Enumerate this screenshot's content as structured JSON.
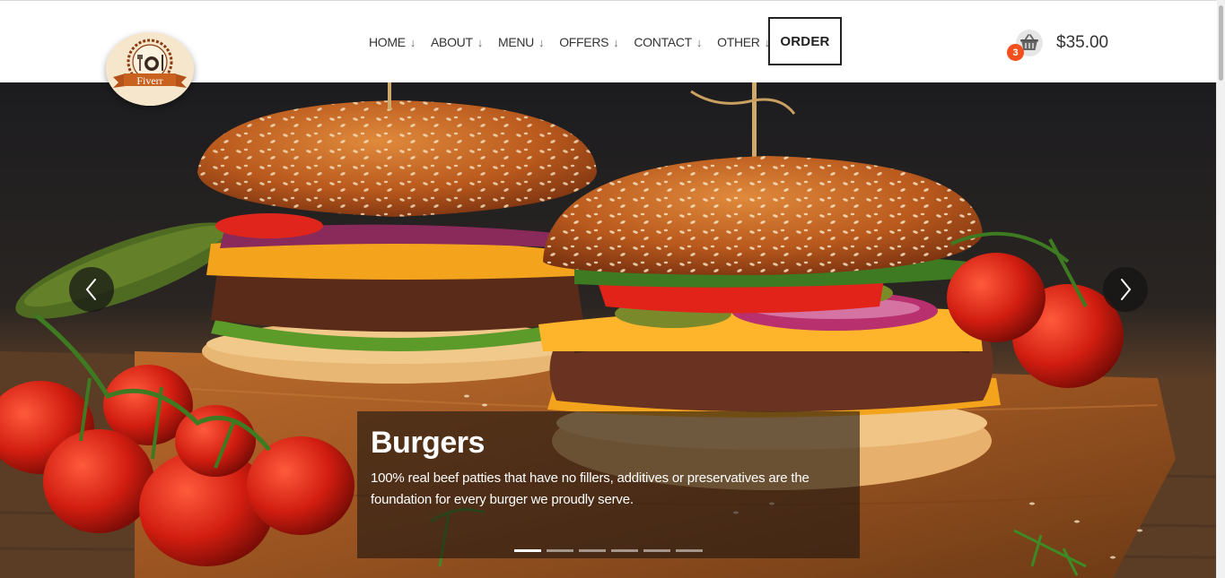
{
  "brand": {
    "logo_text": "Fiverr"
  },
  "nav": {
    "items": [
      {
        "label": "HOME"
      },
      {
        "label": "ABOUT"
      },
      {
        "label": "MENU"
      },
      {
        "label": "OFFERS"
      },
      {
        "label": "CONTACT"
      },
      {
        "label": "OTHER"
      }
    ],
    "dropdown_glyph": "↓",
    "order_label": "ORDER"
  },
  "cart": {
    "icon": "basket-icon",
    "count": "3",
    "total": "$35.00",
    "badge_color": "#f3501d"
  },
  "slider": {
    "prev_icon": "chevron-left-icon",
    "next_icon": "chevron-right-icon",
    "active_slide": 1,
    "slide_count": 6,
    "slide": {
      "title": "Burgers",
      "description": "100% real beef patties that have no fillers, additives or preservatives are the foundation for every burger we proudly serve."
    }
  }
}
